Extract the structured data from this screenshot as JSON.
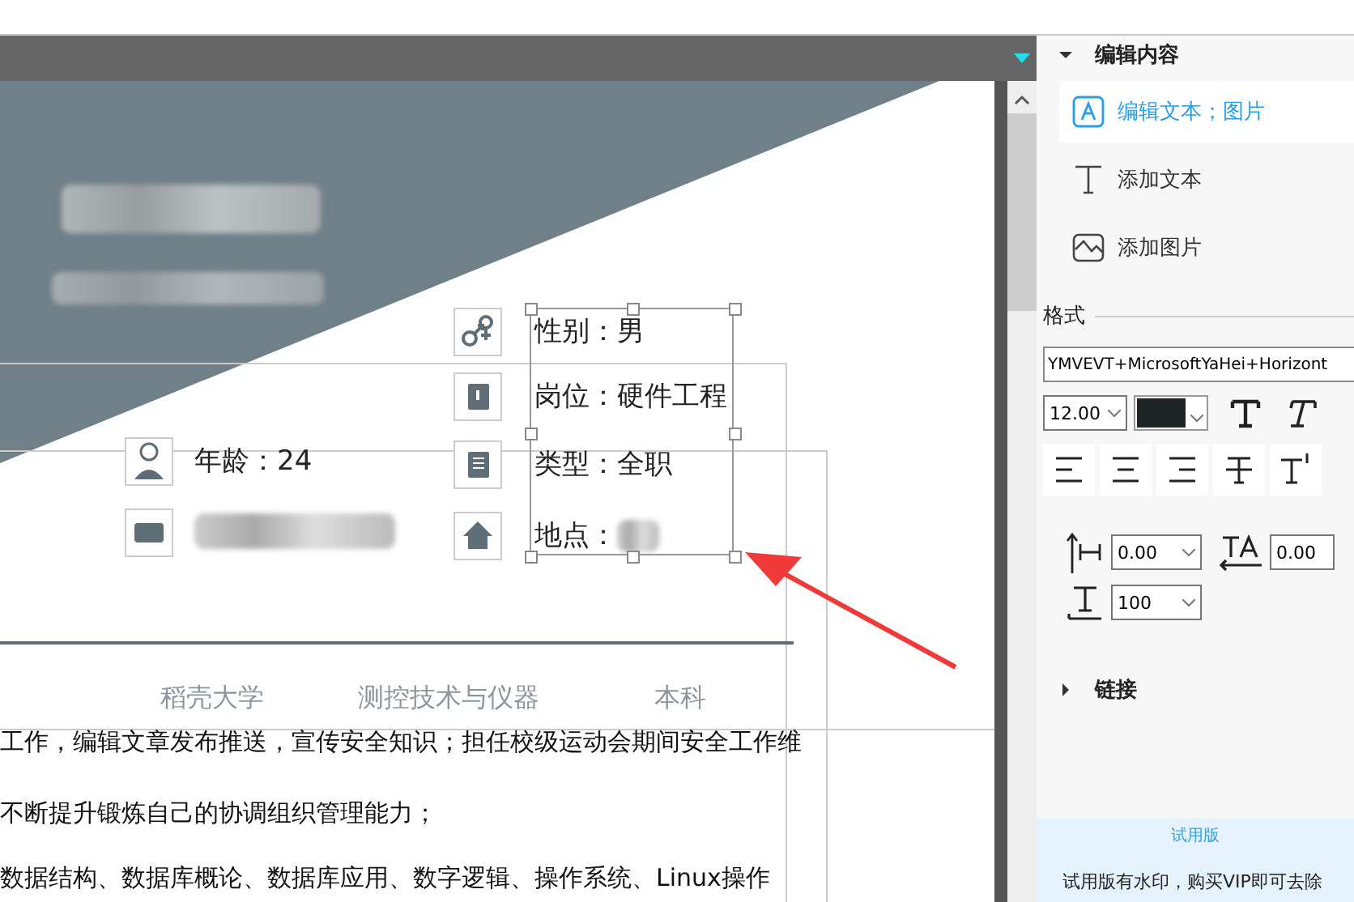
{
  "document": {
    "info_left": [
      {
        "label": "年龄：24",
        "blurred": false
      },
      {
        "blurred": true
      }
    ],
    "info_right": [
      {
        "label": "性别：男",
        "blurred": false
      },
      {
        "label": "岗位：硬件工程",
        "blurred": false
      },
      {
        "label": "类型：全职",
        "blurred": false
      },
      {
        "label": "地点：",
        "blurred": true
      }
    ],
    "education": [
      "稻壳大学",
      "测控技术与仪器",
      "本科"
    ],
    "paragraphs": [
      "工作，编辑文章发布推送，宣传安全知识；担任校级运动会期间安全工作维",
      "不断提升锻炼自己的协调组织管理能力；",
      "数据结构、数据库概论、数据库应用、数字逻辑、操作系统、Linux操作"
    ]
  },
  "panel": {
    "content_section": {
      "title": "编辑内容",
      "expanded": true
    },
    "tools": [
      {
        "label": "编辑文本；图片",
        "selected": true
      },
      {
        "label": "添加文本",
        "selected": false
      },
      {
        "label": "添加图片",
        "selected": false
      }
    ],
    "format": {
      "title": "格式",
      "font": "YMVEVT+MicrosoftYaHei+Horizont",
      "size": "12.00",
      "color": "#1e2326"
    },
    "spacing": {
      "line": "0.00",
      "char": "0.00",
      "scale": "100"
    },
    "link_section": {
      "title": "链接",
      "expanded": false
    },
    "trial": {
      "badge": "试用版",
      "notice": "试用版有水印，购买VIP即可去除"
    }
  }
}
